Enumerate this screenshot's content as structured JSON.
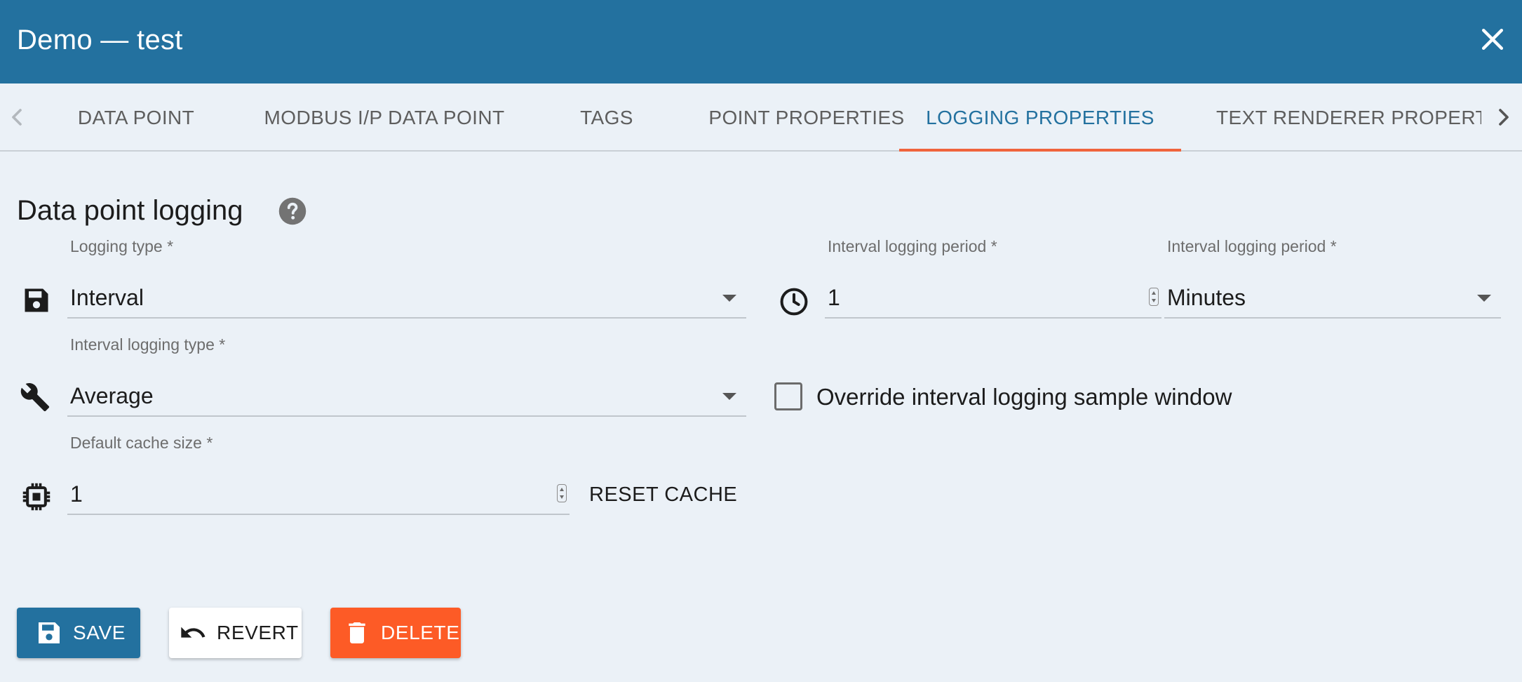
{
  "window": {
    "title": "Demo — test"
  },
  "tabs": [
    {
      "label": "Data point"
    },
    {
      "label": "Modbus I/P data point"
    },
    {
      "label": "Tags"
    },
    {
      "label": "Point properties"
    },
    {
      "label": "Logging properties",
      "active": true
    },
    {
      "label": "Text renderer properties"
    }
  ],
  "section": {
    "title": "Data point logging"
  },
  "fields": {
    "logging_type": {
      "label": "Logging type *",
      "value": "Interval"
    },
    "interval_period_value": {
      "label": "Interval logging period *",
      "value": "1"
    },
    "interval_period_unit": {
      "label": "Interval logging period *",
      "value": "Minutes"
    },
    "interval_logging_type": {
      "label": "Interval logging type *",
      "value": "Average"
    },
    "default_cache_size": {
      "label": "Default cache size *",
      "value": "1"
    }
  },
  "override_sample_window": {
    "label": "Override interval logging sample window",
    "checked": false
  },
  "reset_cache_label": "Reset cache",
  "actions": {
    "save": "Save",
    "revert": "Revert",
    "delete": "Delete"
  },
  "icons": {
    "close": "close-icon",
    "help": "help-circle-icon",
    "logging_type": "floppy-disk-icon",
    "period": "clock-icon",
    "interval_type": "wrench-icon",
    "cache": "chip-icon"
  },
  "colors": {
    "header": "#23719f",
    "background": "#ebf1f7",
    "tab_active": "#23719f",
    "tab_indicator": "#f0643c",
    "delete": "#fd5b26"
  }
}
